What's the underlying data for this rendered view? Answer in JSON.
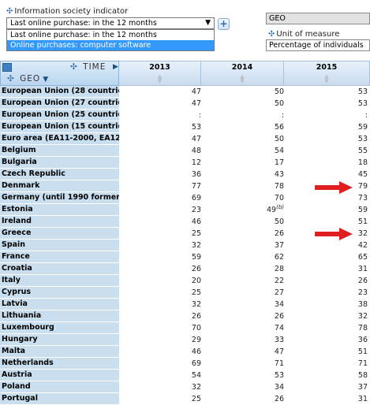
{
  "indicator": {
    "label": "Information society indicator",
    "selected": "Last online purchase: in the 12 months",
    "options": [
      "Last online purchase: in the 12 months",
      "Online purchases: computer software"
    ],
    "add_button": "+"
  },
  "geo_box": "GEO",
  "unit": {
    "label": "Unit of measure",
    "value": "Percentage of individuals"
  },
  "header": {
    "time_label": "TIME",
    "geo_label": "GEO",
    "years": [
      "2013",
      "2014",
      "2015"
    ]
  },
  "rows": [
    {
      "geo": "European Union (28 countries)",
      "v": [
        "47",
        "50",
        "53"
      ]
    },
    {
      "geo": "European Union (27 countries)",
      "v": [
        "47",
        "50",
        "53"
      ]
    },
    {
      "geo": "European Union (25 countries)",
      "v": [
        ":",
        ":",
        ":"
      ]
    },
    {
      "geo": "European Union (15 countries)",
      "v": [
        "53",
        "56",
        "59"
      ]
    },
    {
      "geo": "Euro area (EA11-2000, EA12-2",
      "v": [
        "47",
        "50",
        "53"
      ]
    },
    {
      "geo": "Belgium",
      "v": [
        "48",
        "54",
        "55"
      ]
    },
    {
      "geo": "Bulgaria",
      "v": [
        "12",
        "17",
        "18"
      ]
    },
    {
      "geo": "Czech Republic",
      "v": [
        "36",
        "43",
        "45"
      ]
    },
    {
      "geo": "Denmark",
      "v": [
        "77",
        "78",
        "79"
      ]
    },
    {
      "geo": "Germany (until 1990 former te",
      "v": [
        "69",
        "70",
        "73"
      ]
    },
    {
      "geo": "Estonia",
      "v": [
        "23",
        "49",
        "59"
      ],
      "flag": "(b)"
    },
    {
      "geo": "Ireland",
      "v": [
        "46",
        "50",
        "51"
      ]
    },
    {
      "geo": "Greece",
      "v": [
        "25",
        "26",
        "32"
      ]
    },
    {
      "geo": "Spain",
      "v": [
        "32",
        "37",
        "42"
      ]
    },
    {
      "geo": "France",
      "v": [
        "59",
        "62",
        "65"
      ]
    },
    {
      "geo": "Croatia",
      "v": [
        "26",
        "28",
        "31"
      ]
    },
    {
      "geo": "Italy",
      "v": [
        "20",
        "22",
        "26"
      ]
    },
    {
      "geo": "Cyprus",
      "v": [
        "25",
        "27",
        "23"
      ]
    },
    {
      "geo": "Latvia",
      "v": [
        "32",
        "34",
        "38"
      ]
    },
    {
      "geo": "Lithuania",
      "v": [
        "26",
        "26",
        "32"
      ]
    },
    {
      "geo": "Luxembourg",
      "v": [
        "70",
        "74",
        "78"
      ]
    },
    {
      "geo": "Hungary",
      "v": [
        "29",
        "33",
        "36"
      ]
    },
    {
      "geo": "Malta",
      "v": [
        "46",
        "47",
        "51"
      ]
    },
    {
      "geo": "Netherlands",
      "v": [
        "69",
        "71",
        "71"
      ]
    },
    {
      "geo": "Austria",
      "v": [
        "54",
        "53",
        "58"
      ]
    },
    {
      "geo": "Poland",
      "v": [
        "32",
        "34",
        "37"
      ]
    },
    {
      "geo": "Portugal",
      "v": [
        "25",
        "26",
        "31"
      ]
    }
  ],
  "colors": {
    "annotation_arrow": "#e02020",
    "geo_column": "#c9dfef",
    "header_accent": "#3d80c3"
  }
}
